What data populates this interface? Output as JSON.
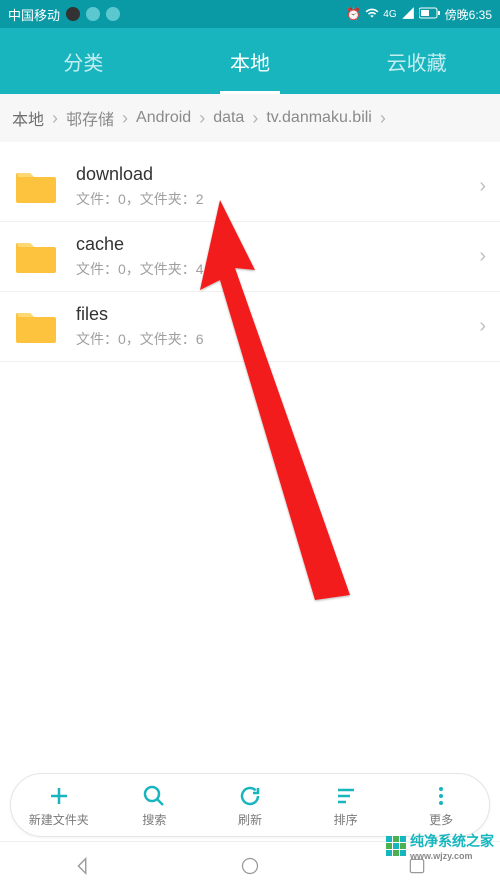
{
  "statusbar": {
    "carrier": "中国移动",
    "time": "傍晚6:35",
    "network": "4G"
  },
  "tabs": {
    "category": "分类",
    "local": "本地",
    "cloud": "云收藏"
  },
  "breadcrumb": {
    "items": [
      "本地",
      "邨存储",
      "Android",
      "data",
      "tv.danmaku.bili"
    ]
  },
  "folders": [
    {
      "name": "download",
      "meta": "文件：0，文件夹：2"
    },
    {
      "name": "cache",
      "meta": "文件：0，文件夹：4"
    },
    {
      "name": "files",
      "meta": "文件：0，文件夹：6"
    }
  ],
  "bottombar": {
    "new_folder": "新建文件夹",
    "search": "搜索",
    "refresh": "刷新",
    "sort": "排序",
    "more": "更多"
  },
  "watermark": {
    "text": "纯净系统之家",
    "url": "www.wjzy.com"
  }
}
